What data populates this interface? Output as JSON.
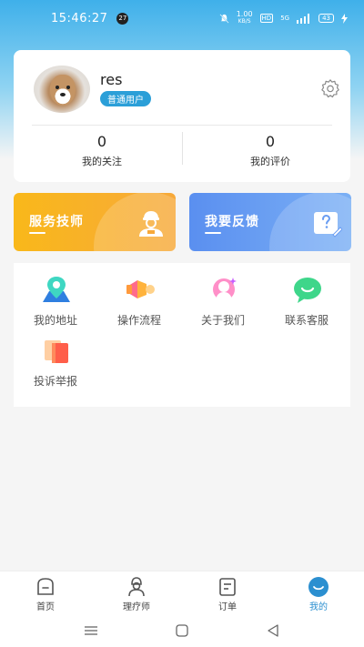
{
  "status_bar": {
    "time": "15:46:27",
    "notification_count": "27",
    "net_speed_value": "1.00",
    "net_speed_unit": "KB/S",
    "hd": "HD",
    "signal": "5G",
    "battery": "43"
  },
  "profile": {
    "username": "res",
    "role_tag": "普通用户",
    "following_count": "0",
    "following_label": "我的关注",
    "reviews_count": "0",
    "reviews_label": "我的评价"
  },
  "promos": {
    "service_title": "服务技师",
    "feedback_title": "我要反馈"
  },
  "menu": {
    "items": [
      {
        "label": "我的地址",
        "icon": "location-pin-icon"
      },
      {
        "label": "操作流程",
        "icon": "megaphone-icon"
      },
      {
        "label": "关于我们",
        "icon": "person-sparkle-icon"
      },
      {
        "label": "联系客服",
        "icon": "chat-bubble-icon"
      },
      {
        "label": "投诉举报",
        "icon": "report-card-icon"
      }
    ]
  },
  "bottom_nav": {
    "items": [
      {
        "label": "首页",
        "icon": "home-icon"
      },
      {
        "label": "理疗师",
        "icon": "therapist-icon"
      },
      {
        "label": "订单",
        "icon": "order-list-icon"
      },
      {
        "label": "我的",
        "icon": "profile-smile-icon"
      }
    ],
    "active": "我的"
  },
  "colors": {
    "accent": "#2b9fd8",
    "service_card": "#f9b81a",
    "feedback_card": "#5a8ff0"
  }
}
